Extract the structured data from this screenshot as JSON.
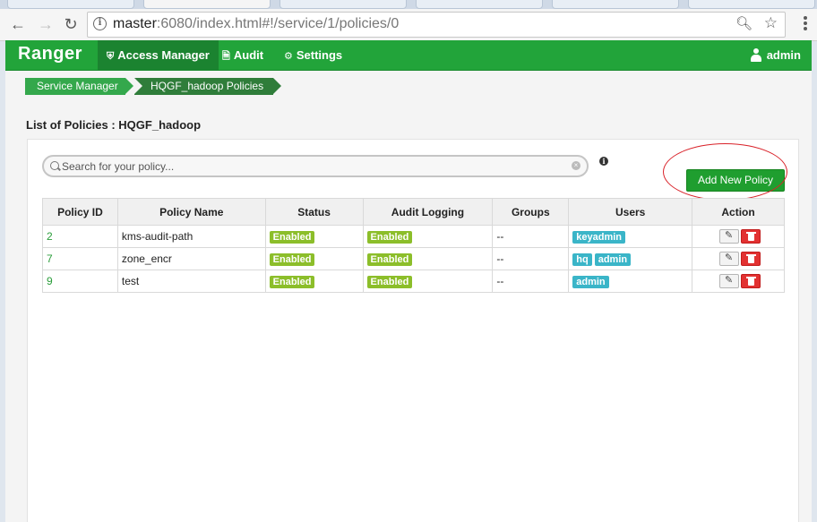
{
  "browser": {
    "url_host": "master",
    "url_rest": ":6080/index.html#!/service/1/policies/0"
  },
  "navbar": {
    "brand": "Ranger",
    "items": [
      {
        "label": "Access Manager",
        "active": true,
        "icon": "shield-icon"
      },
      {
        "label": "Audit",
        "active": false,
        "icon": "file-icon"
      },
      {
        "label": "Settings",
        "active": false,
        "icon": "gear-icon"
      }
    ],
    "user": "admin"
  },
  "breadcrumb": [
    "Service Manager",
    "HQGF_hadoop Policies"
  ],
  "page_title": "List of Policies : HQGF_hadoop",
  "search": {
    "placeholder": "Search for your policy..."
  },
  "add_button": "Add New Policy",
  "table": {
    "headers": [
      "Policy ID",
      "Policy Name",
      "Status",
      "Audit Logging",
      "Groups",
      "Users",
      "Action"
    ],
    "rows": [
      {
        "id": "2",
        "name": "kms-audit-path",
        "status": "Enabled",
        "audit": "Enabled",
        "groups": "--",
        "users": [
          "keyadmin"
        ]
      },
      {
        "id": "7",
        "name": "zone_encr",
        "status": "Enabled",
        "audit": "Enabled",
        "groups": "--",
        "users": [
          "hq",
          "admin"
        ]
      },
      {
        "id": "9",
        "name": "test",
        "status": "Enabled",
        "audit": "Enabled",
        "groups": "--",
        "users": [
          "admin"
        ]
      }
    ]
  },
  "colors": {
    "navbar": "#22a43a",
    "navbar_active": "#1b8330",
    "status_label": "#8cbe2a",
    "user_label": "#3ab5c8",
    "delete": "#e23131",
    "highlight_circle": "#d9232a"
  }
}
